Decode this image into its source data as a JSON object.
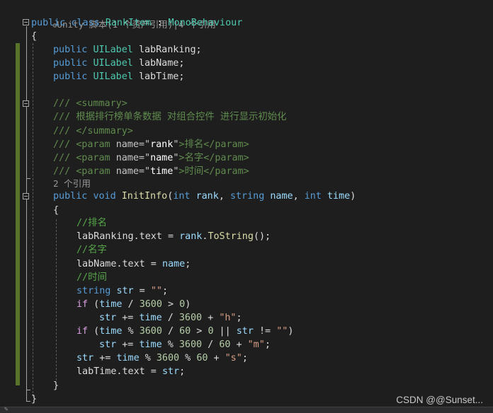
{
  "codelens": {
    "class_refs": "Unity 脚本(1 个资产引用)|4 个引用",
    "method_refs": "2 个引用"
  },
  "code": {
    "class_decl": {
      "public": "public",
      "class": "class",
      "name": "RankItem",
      "colon": " : ",
      "base": "MonoBehaviour"
    },
    "open_brace": "{",
    "fields": [
      {
        "mod": "public",
        "type": "UILabel",
        "name": "labRanking;"
      },
      {
        "mod": "public",
        "type": "UILabel",
        "name": "labName;"
      },
      {
        "mod": "public",
        "type": "UILabel",
        "name": "labTime;"
      }
    ],
    "doc": {
      "summary_open": "/// <summary>",
      "summary_text": "/// 根据排行榜单条数据 对组合控件 进行显示初始化",
      "summary_close": "/// </summary>",
      "params": [
        {
          "prefix": "/// <param ",
          "attr": "name=",
          "q1": "\"",
          "value": "rank",
          "q2": "\"",
          "gt": ">",
          "text": "排名",
          "close": "</param>"
        },
        {
          "prefix": "/// <param ",
          "attr": "name=",
          "q1": "\"",
          "value": "name",
          "q2": "\"",
          "gt": ">",
          "text": "名字",
          "close": "</param>"
        },
        {
          "prefix": "/// <param ",
          "attr": "name=",
          "q1": "\"",
          "value": "time",
          "q2": "\"",
          "gt": ">",
          "text": "时间",
          "close": "</param>"
        }
      ]
    },
    "method_decl": {
      "public": "public",
      "void": "void",
      "name": "InitInfo",
      "lparen": "(",
      "int1": "int",
      "p1": "rank",
      "comma1": ", ",
      "string": "string",
      "p2": "name",
      "comma2": ", ",
      "int2": "int",
      "p3": "time",
      "rparen": ")"
    },
    "method_open": "{",
    "body": {
      "c_rank": "//排名",
      "l1": {
        "a": "labRanking.text = ",
        "b": "rank",
        "c": ".",
        "d": "ToString",
        "e": "();"
      },
      "c_name": "//名字",
      "l2": {
        "a": "labName.text = ",
        "b": "name",
        "c": ";"
      },
      "c_time": "//时间",
      "l3": {
        "a": "string",
        "b": " ",
        "c": "str",
        "d": " = ",
        "e": "\"\"",
        "f": ";"
      },
      "l4": {
        "a": "if",
        "b": " (",
        "c": "time",
        "d": " / ",
        "e": "3600",
        "f": " > ",
        "g": "0",
        "h": ")"
      },
      "l5": {
        "a": "str",
        "b": " += ",
        "c": "time",
        "d": " / ",
        "e": "3600",
        "f": " + ",
        "g": "\"h\"",
        "h": ";"
      },
      "l6": {
        "a": "if",
        "b": " (",
        "c": "time",
        "d": " % ",
        "e": "3600",
        "f": " / ",
        "g": "60",
        "h": " > ",
        "i": "0",
        "j": " || ",
        "k": "str",
        "l": " != ",
        "m": "\"\"",
        "n": ")"
      },
      "l7": {
        "a": "str",
        "b": " += ",
        "c": "time",
        "d": " % ",
        "e": "3600",
        "f": " / ",
        "g": "60",
        "h": " + ",
        "i": "\"m\"",
        "j": ";"
      },
      "l8": {
        "a": "str",
        "b": " += ",
        "c": "time",
        "d": " % ",
        "e": "3600",
        "f": " % ",
        "g": "60",
        "h": " + ",
        "i": "\"s\"",
        "j": ";"
      },
      "l9": {
        "a": "labTime.text = ",
        "b": "str",
        "c": ";"
      }
    },
    "method_close": "}",
    "class_close": "}"
  },
  "watermark": "CSDN @@Sunset..."
}
